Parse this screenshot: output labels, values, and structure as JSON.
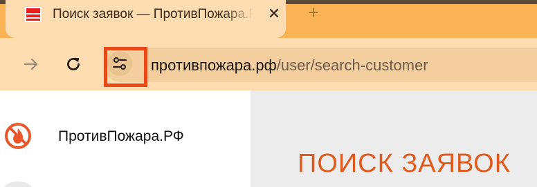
{
  "browser": {
    "tab": {
      "title": "Поиск заявок — ПротивПожара.РФ",
      "favicon": "brand-logo",
      "close_symbol": "✕"
    },
    "new_tab_symbol": "+",
    "toolbar": {
      "forward_icon": "arrow-right-icon",
      "reload_icon": "reload-icon",
      "site_info_icon": "tune-icon",
      "url_host": "противпожара.рф",
      "url_path": "/user/search-customer"
    },
    "highlight_color": "#e84a1a"
  },
  "page": {
    "sidebar": {
      "brand_name": "ПротивПожара.РФ",
      "logo_icon": "fire-ban-icon"
    },
    "main": {
      "heading": "ПОИСК ЗАЯВОК"
    }
  },
  "colors": {
    "accent": "#e05a1e",
    "tabstrip": "#f9b254",
    "toolbar": "#fcdcb0"
  }
}
